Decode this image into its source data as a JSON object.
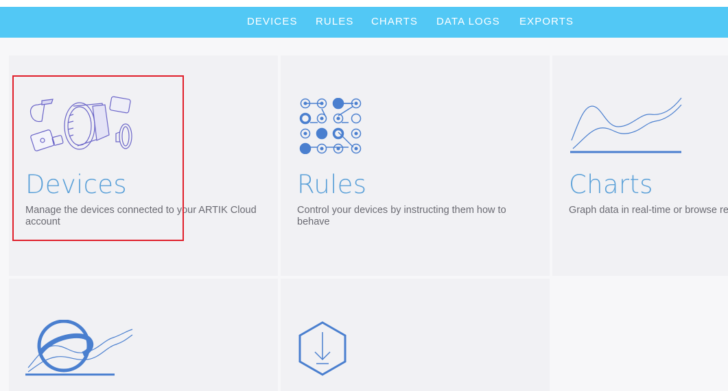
{
  "nav": {
    "items": [
      {
        "label": "DEVICES"
      },
      {
        "label": "RULES"
      },
      {
        "label": "CHARTS"
      },
      {
        "label": "DATA LOGS"
      },
      {
        "label": "EXPORTS"
      }
    ],
    "background": "#52c8f5"
  },
  "tiles": {
    "devices": {
      "icon": "devices-wearables-icon",
      "title": "Devices",
      "description": "Manage the devices connected to your ARTIK Cloud account"
    },
    "rules": {
      "icon": "rules-nodes-icon",
      "title": "Rules",
      "description": "Control your devices by instructing them how to behave"
    },
    "charts": {
      "icon": "charts-lines-icon",
      "title": "Charts",
      "description": "Graph data in real-time or browse records"
    },
    "data_logs": {
      "icon": "data-logs-icon"
    },
    "exports": {
      "icon": "export-hexagon-icon"
    }
  },
  "colors": {
    "accent": "#5aa0d8",
    "icon_blue": "#4a7fcf",
    "tile_bg": "#f1f1f4",
    "highlight": "#e01e2a"
  }
}
